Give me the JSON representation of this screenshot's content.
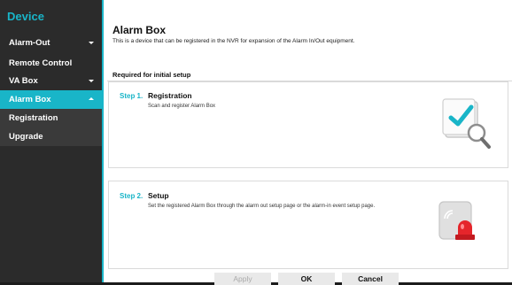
{
  "sidebar": {
    "title": "Device",
    "items": [
      {
        "label": "Alarm-Out"
      },
      {
        "label": "Remote Control"
      },
      {
        "label": "VA Box"
      },
      {
        "label": "Alarm Box"
      },
      {
        "label": "Registration"
      },
      {
        "label": "Upgrade"
      }
    ]
  },
  "main": {
    "title": "Alarm Box",
    "description": "This is a device that can be registered in the NVR for expansion of the Alarm In/Out equipment.",
    "required_label": "Required for initial setup",
    "steps": [
      {
        "number": "Step 1.",
        "name": "Registration",
        "desc": "Scan and register Alarm Box",
        "icon": "registration-scan-icon"
      },
      {
        "number": "Step 2.",
        "name": "Setup",
        "desc": "Set the registered Alarm Box through the alarm out setup page or the alarm-in event setup page.",
        "icon": "alarm-siren-icon"
      }
    ]
  },
  "buttons": {
    "apply": "Apply",
    "ok": "OK",
    "cancel": "Cancel"
  },
  "colors": {
    "accent": "#19b5c8",
    "sidebar_bg": "#2b2b2b"
  }
}
